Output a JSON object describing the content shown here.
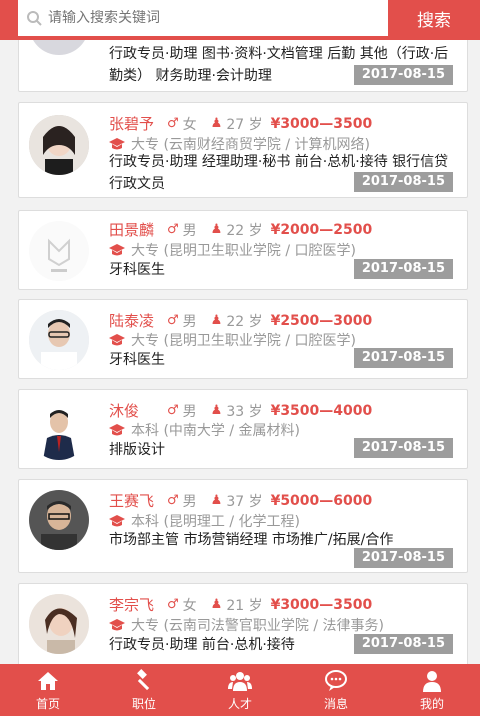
{
  "search": {
    "placeholder": "请输入搜索关键词",
    "button_label": "搜索"
  },
  "icons": {
    "male": "♂",
    "age": "person-icon",
    "education": "graduation-cap-icon"
  },
  "colors": {
    "accent": "#e24f4b",
    "date_badge": "#9d9d9d"
  },
  "candidates": [
    {
      "name": "",
      "gender": "",
      "age": "",
      "salary": "",
      "education": "",
      "jobs": "行政专员·助理 图书·资料·文档管理 后勤 其他（行政·后勤类） 财务助理·会计助理",
      "date": "2017-08-15"
    },
    {
      "name": "张碧予",
      "gender": "女",
      "age": "27 岁",
      "salary": "¥3000—3500",
      "education": "大专 (云南财经商贸学院 / 计算机网络)",
      "jobs": "行政专员·助理 经理助理·秘书 前台·总机·接待 银行信贷 行政文员",
      "date": "2017-08-15"
    },
    {
      "name": "田景麟",
      "gender": "男",
      "age": "22 岁",
      "salary": "¥2000—2500",
      "education": "大专 (昆明卫生职业学院 / 口腔医学)",
      "jobs": "牙科医生",
      "date": "2017-08-15"
    },
    {
      "name": "陆泰凌",
      "gender": "男",
      "age": "22 岁",
      "salary": "¥2500—3000",
      "education": "大专 (昆明卫生职业学院 / 口腔医学)",
      "jobs": "牙科医生",
      "date": "2017-08-15"
    },
    {
      "name": "沐俊",
      "gender": "男",
      "age": "33 岁",
      "salary": "¥3500—4000",
      "education": "本科 (中南大学 / 金属材料)",
      "jobs": "排版设计",
      "date": "2017-08-15"
    },
    {
      "name": "王赛飞",
      "gender": "男",
      "age": "37 岁",
      "salary": "¥5000—6000",
      "education": "本科 (昆明理工 / 化学工程)",
      "jobs": "市场部主管 市场营销经理 市场推广/拓展/合作",
      "date": "2017-08-15"
    },
    {
      "name": "李宗飞",
      "gender": "女",
      "age": "21 岁",
      "salary": "¥3000—3500",
      "education": "大专 (云南司法警官职业学院 / 法律事务)",
      "jobs": "行政专员·助理 前台·总机·接待",
      "date": "2017-08-15"
    }
  ],
  "tabs": [
    {
      "label": "首页",
      "icon": "home-icon"
    },
    {
      "label": "职位",
      "icon": "gavel-icon"
    },
    {
      "label": "人才",
      "icon": "people-icon"
    },
    {
      "label": "消息",
      "icon": "chat-icon"
    },
    {
      "label": "我的",
      "icon": "user-icon"
    }
  ]
}
